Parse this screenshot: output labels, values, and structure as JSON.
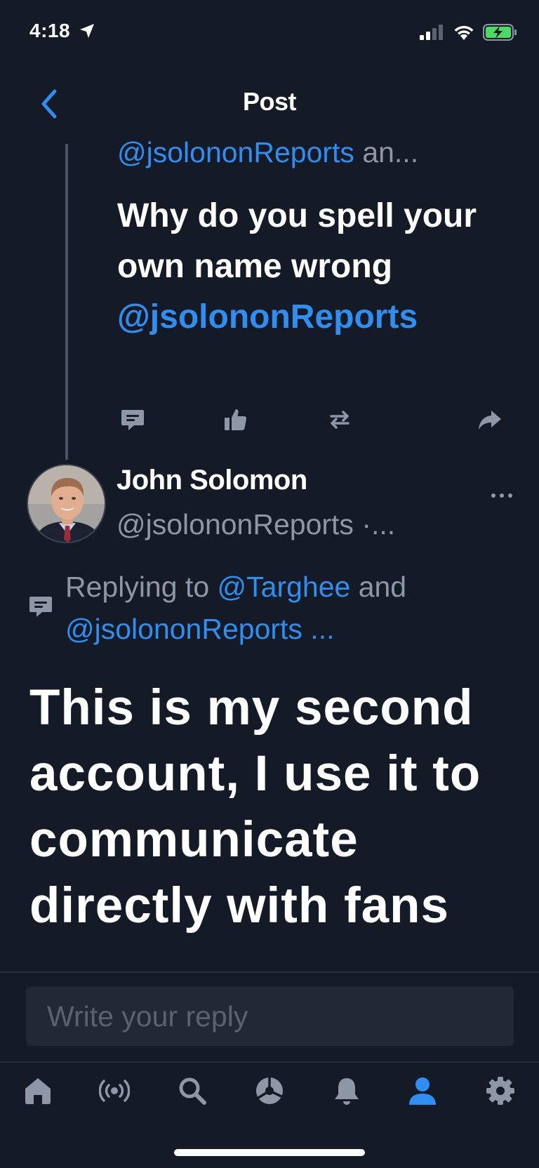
{
  "status": {
    "time": "4:18"
  },
  "header": {
    "title": "Post"
  },
  "parent_post": {
    "mention": "@jsolononReports",
    "meta_suffix": " an...",
    "text_plain": "Why do you spell your own name wrong ",
    "text_mention": "@jsolononReports"
  },
  "post": {
    "author_name": "John Solomon",
    "author_handle": "@jsolononReports",
    "handle_suffix": " ·...",
    "reply_prefix": "Replying to ",
    "reply_mention_1": "@Targhee",
    "reply_and": " and",
    "reply_mention_2": "@jsolononReports ...",
    "text": "This is my second account, I use it to communicate directly with fans"
  },
  "composer": {
    "placeholder": "Write your reply"
  },
  "icons": {
    "back": "chevron-left-icon",
    "parent_actions": [
      "comment-icon",
      "thumbs-up-icon",
      "repost-icon",
      "share-icon"
    ],
    "tabs": [
      "home-icon",
      "broadcast-icon",
      "search-icon",
      "feeds-icon",
      "bell-icon",
      "profile-icon",
      "gear-icon"
    ]
  },
  "colors": {
    "accent": "#2f8ef1",
    "background": "#141b26",
    "muted": "#8e97a6",
    "battery": "#4cd964"
  }
}
